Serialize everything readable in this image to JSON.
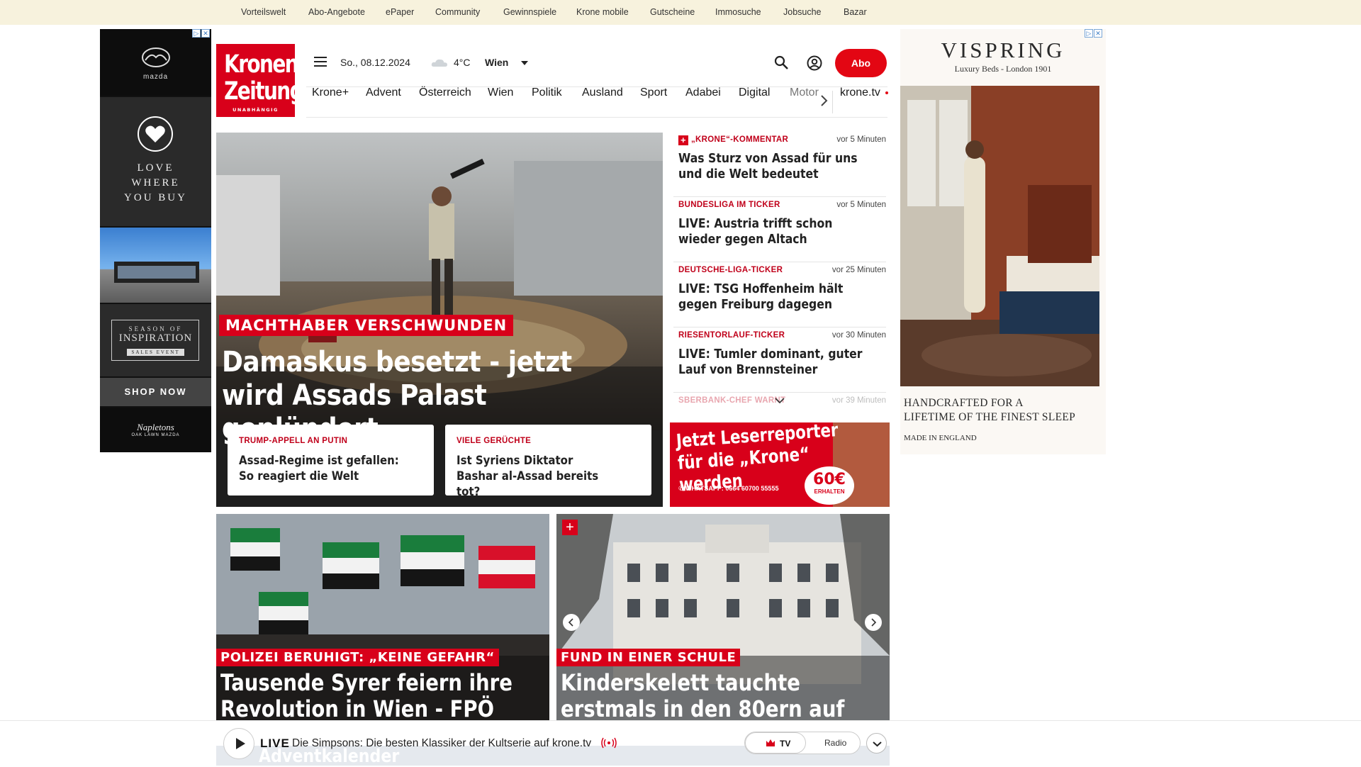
{
  "top_nav": [
    "Vorteilswelt",
    "Abo-Angebote",
    "ePaper",
    "Community",
    "Gewinnspiele",
    "Krone mobile",
    "Gutscheine",
    "Immosuche",
    "Jobsuche",
    "Bazar"
  ],
  "logo": {
    "line1": "Kronen",
    "line2": "Zeitung",
    "line3": "UNABHÄNGIG"
  },
  "header": {
    "date": "So., 08.12.2024",
    "temperature": "4°C",
    "city": "Wien",
    "abo_label": "Abo",
    "weather_icon": "cloud-icon",
    "search_icon": "search-icon",
    "user_icon": "user-icon"
  },
  "sections": [
    "Krone+",
    "Advent",
    "Österreich",
    "Wien",
    "Politik",
    "Ausland",
    "Sport",
    "Adabei",
    "Digital",
    "Motor",
    "krone.tv"
  ],
  "hero": {
    "kicker": "MACHTHABER VERSCHWUNDEN",
    "title": "Damaskus besetzt - jetzt wird Assads Palast geplündert",
    "subcards": [
      {
        "kicker": "TRUMP-APPELL AN PUTIN",
        "title": "Assad-Regime ist gefallen: So reagiert die Welt"
      },
      {
        "kicker": "VIELE GERÜCHTE",
        "title": "Ist Syriens Diktator Bashar al-Assad bereits tot?"
      }
    ]
  },
  "ticker": [
    {
      "kicker": "„KRONE“-KOMMENTAR",
      "time": "vor 5 Minuten",
      "title": "Was Sturz von Assad für uns und die Welt bedeutet",
      "plus": true
    },
    {
      "kicker": "BUNDESLIGA IM TICKER",
      "time": "vor 5 Minuten",
      "title": "LIVE: Austria trifft schon wieder gegen Altach",
      "plus": false
    },
    {
      "kicker": "DEUTSCHE-LIGA-TICKER",
      "time": "vor 25 Minuten",
      "title": "LIVE: TSG Hoffenheim hält gegen Freiburg dagegen",
      "plus": false
    },
    {
      "kicker": "RIESENTORLAUF-TICKER",
      "time": "vor 30 Minuten",
      "title": "LIVE: Tumler dominant, guter Lauf von Brennsteiner",
      "plus": false
    },
    {
      "kicker": "SBERBANK-CHEF WARNT",
      "time": "vor 39 Minuten",
      "title": "",
      "plus": false
    }
  ],
  "leser_ad": {
    "line1": "Jetzt Leserreporter",
    "line2": "für die „Krone“ werden",
    "whatsapp": "WHATSAPP: 0664 60700 55555",
    "amount": "60€",
    "amount_note": "ERHALTEN"
  },
  "cards": [
    {
      "kicker": "POLIZEI BERUHIGT: „KEINE GEFAHR“",
      "title": "Tausende Syrer feiern ihre Revolution in Wien - FPÖ tobt"
    },
    {
      "kicker": "FUND IN EINER SCHULE",
      "title": "Kinderskelett tauchte erstmals in den 80ern auf"
    }
  ],
  "live": {
    "label": "LIVE",
    "text": "Die Simpsons: Die besten Klassiker der Kultserie auf krone.tv",
    "tv": "TV",
    "radio": "Radio"
  },
  "advent_teaser": "Adventkalender",
  "left_ad": {
    "brand": "mazda",
    "heart_text": [
      "LOVE",
      "WHERE",
      "YOU BUY"
    ],
    "season": [
      "SEASON OF",
      "INSPIRATION",
      "SALES EVENT"
    ],
    "shop": "SHOP NOW",
    "dealer": "Napletons",
    "dealer_sub": "OAK LAWN MAZDA"
  },
  "right_ad": {
    "brand": "VISPRING",
    "sub": "Luxury Beds - London 1901",
    "caption": [
      "HANDCRAFTED FOR A",
      "LIFETIME OF THE FINEST SLEEP"
    ],
    "made": "MADE IN ENGLAND"
  },
  "colors": {
    "brand_red": "#d8001a",
    "topnav_bg": "#f7f2dd"
  }
}
